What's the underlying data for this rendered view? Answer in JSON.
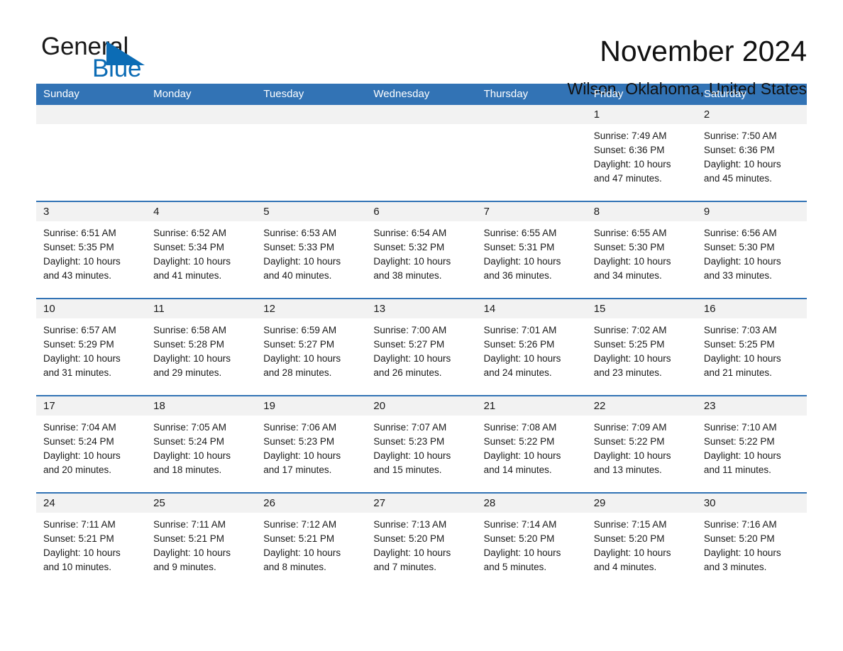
{
  "brand": {
    "name_part1": "General",
    "name_part2": "Blue",
    "logo_icon": "triangle-flag-icon",
    "accent_color": "#0c6cb5"
  },
  "header": {
    "month_title": "November 2024",
    "location": "Wilson, Oklahoma, United States"
  },
  "calendar": {
    "header_bg": "#3273b5",
    "row_border_color": "#3273b5",
    "day_strip_bg": "#f2f2f2",
    "weekdays": [
      "Sunday",
      "Monday",
      "Tuesday",
      "Wednesday",
      "Thursday",
      "Friday",
      "Saturday"
    ],
    "weeks": [
      [
        {
          "day": "",
          "sunrise": "",
          "sunset": "",
          "daylight_line1": "",
          "daylight_line2": "",
          "empty": true
        },
        {
          "day": "",
          "sunrise": "",
          "sunset": "",
          "daylight_line1": "",
          "daylight_line2": "",
          "empty": true
        },
        {
          "day": "",
          "sunrise": "",
          "sunset": "",
          "daylight_line1": "",
          "daylight_line2": "",
          "empty": true
        },
        {
          "day": "",
          "sunrise": "",
          "sunset": "",
          "daylight_line1": "",
          "daylight_line2": "",
          "empty": true
        },
        {
          "day": "",
          "sunrise": "",
          "sunset": "",
          "daylight_line1": "",
          "daylight_line2": "",
          "empty": true
        },
        {
          "day": "1",
          "sunrise": "Sunrise: 7:49 AM",
          "sunset": "Sunset: 6:36 PM",
          "daylight_line1": "Daylight: 10 hours",
          "daylight_line2": "and 47 minutes.",
          "empty": false
        },
        {
          "day": "2",
          "sunrise": "Sunrise: 7:50 AM",
          "sunset": "Sunset: 6:36 PM",
          "daylight_line1": "Daylight: 10 hours",
          "daylight_line2": "and 45 minutes.",
          "empty": false
        }
      ],
      [
        {
          "day": "3",
          "sunrise": "Sunrise: 6:51 AM",
          "sunset": "Sunset: 5:35 PM",
          "daylight_line1": "Daylight: 10 hours",
          "daylight_line2": "and 43 minutes.",
          "empty": false
        },
        {
          "day": "4",
          "sunrise": "Sunrise: 6:52 AM",
          "sunset": "Sunset: 5:34 PM",
          "daylight_line1": "Daylight: 10 hours",
          "daylight_line2": "and 41 minutes.",
          "empty": false
        },
        {
          "day": "5",
          "sunrise": "Sunrise: 6:53 AM",
          "sunset": "Sunset: 5:33 PM",
          "daylight_line1": "Daylight: 10 hours",
          "daylight_line2": "and 40 minutes.",
          "empty": false
        },
        {
          "day": "6",
          "sunrise": "Sunrise: 6:54 AM",
          "sunset": "Sunset: 5:32 PM",
          "daylight_line1": "Daylight: 10 hours",
          "daylight_line2": "and 38 minutes.",
          "empty": false
        },
        {
          "day": "7",
          "sunrise": "Sunrise: 6:55 AM",
          "sunset": "Sunset: 5:31 PM",
          "daylight_line1": "Daylight: 10 hours",
          "daylight_line2": "and 36 minutes.",
          "empty": false
        },
        {
          "day": "8",
          "sunrise": "Sunrise: 6:55 AM",
          "sunset": "Sunset: 5:30 PM",
          "daylight_line1": "Daylight: 10 hours",
          "daylight_line2": "and 34 minutes.",
          "empty": false
        },
        {
          "day": "9",
          "sunrise": "Sunrise: 6:56 AM",
          "sunset": "Sunset: 5:30 PM",
          "daylight_line1": "Daylight: 10 hours",
          "daylight_line2": "and 33 minutes.",
          "empty": false
        }
      ],
      [
        {
          "day": "10",
          "sunrise": "Sunrise: 6:57 AM",
          "sunset": "Sunset: 5:29 PM",
          "daylight_line1": "Daylight: 10 hours",
          "daylight_line2": "and 31 minutes.",
          "empty": false
        },
        {
          "day": "11",
          "sunrise": "Sunrise: 6:58 AM",
          "sunset": "Sunset: 5:28 PM",
          "daylight_line1": "Daylight: 10 hours",
          "daylight_line2": "and 29 minutes.",
          "empty": false
        },
        {
          "day": "12",
          "sunrise": "Sunrise: 6:59 AM",
          "sunset": "Sunset: 5:27 PM",
          "daylight_line1": "Daylight: 10 hours",
          "daylight_line2": "and 28 minutes.",
          "empty": false
        },
        {
          "day": "13",
          "sunrise": "Sunrise: 7:00 AM",
          "sunset": "Sunset: 5:27 PM",
          "daylight_line1": "Daylight: 10 hours",
          "daylight_line2": "and 26 minutes.",
          "empty": false
        },
        {
          "day": "14",
          "sunrise": "Sunrise: 7:01 AM",
          "sunset": "Sunset: 5:26 PM",
          "daylight_line1": "Daylight: 10 hours",
          "daylight_line2": "and 24 minutes.",
          "empty": false
        },
        {
          "day": "15",
          "sunrise": "Sunrise: 7:02 AM",
          "sunset": "Sunset: 5:25 PM",
          "daylight_line1": "Daylight: 10 hours",
          "daylight_line2": "and 23 minutes.",
          "empty": false
        },
        {
          "day": "16",
          "sunrise": "Sunrise: 7:03 AM",
          "sunset": "Sunset: 5:25 PM",
          "daylight_line1": "Daylight: 10 hours",
          "daylight_line2": "and 21 minutes.",
          "empty": false
        }
      ],
      [
        {
          "day": "17",
          "sunrise": "Sunrise: 7:04 AM",
          "sunset": "Sunset: 5:24 PM",
          "daylight_line1": "Daylight: 10 hours",
          "daylight_line2": "and 20 minutes.",
          "empty": false
        },
        {
          "day": "18",
          "sunrise": "Sunrise: 7:05 AM",
          "sunset": "Sunset: 5:24 PM",
          "daylight_line1": "Daylight: 10 hours",
          "daylight_line2": "and 18 minutes.",
          "empty": false
        },
        {
          "day": "19",
          "sunrise": "Sunrise: 7:06 AM",
          "sunset": "Sunset: 5:23 PM",
          "daylight_line1": "Daylight: 10 hours",
          "daylight_line2": "and 17 minutes.",
          "empty": false
        },
        {
          "day": "20",
          "sunrise": "Sunrise: 7:07 AM",
          "sunset": "Sunset: 5:23 PM",
          "daylight_line1": "Daylight: 10 hours",
          "daylight_line2": "and 15 minutes.",
          "empty": false
        },
        {
          "day": "21",
          "sunrise": "Sunrise: 7:08 AM",
          "sunset": "Sunset: 5:22 PM",
          "daylight_line1": "Daylight: 10 hours",
          "daylight_line2": "and 14 minutes.",
          "empty": false
        },
        {
          "day": "22",
          "sunrise": "Sunrise: 7:09 AM",
          "sunset": "Sunset: 5:22 PM",
          "daylight_line1": "Daylight: 10 hours",
          "daylight_line2": "and 13 minutes.",
          "empty": false
        },
        {
          "day": "23",
          "sunrise": "Sunrise: 7:10 AM",
          "sunset": "Sunset: 5:22 PM",
          "daylight_line1": "Daylight: 10 hours",
          "daylight_line2": "and 11 minutes.",
          "empty": false
        }
      ],
      [
        {
          "day": "24",
          "sunrise": "Sunrise: 7:11 AM",
          "sunset": "Sunset: 5:21 PM",
          "daylight_line1": "Daylight: 10 hours",
          "daylight_line2": "and 10 minutes.",
          "empty": false
        },
        {
          "day": "25",
          "sunrise": "Sunrise: 7:11 AM",
          "sunset": "Sunset: 5:21 PM",
          "daylight_line1": "Daylight: 10 hours",
          "daylight_line2": "and 9 minutes.",
          "empty": false
        },
        {
          "day": "26",
          "sunrise": "Sunrise: 7:12 AM",
          "sunset": "Sunset: 5:21 PM",
          "daylight_line1": "Daylight: 10 hours",
          "daylight_line2": "and 8 minutes.",
          "empty": false
        },
        {
          "day": "27",
          "sunrise": "Sunrise: 7:13 AM",
          "sunset": "Sunset: 5:20 PM",
          "daylight_line1": "Daylight: 10 hours",
          "daylight_line2": "and 7 minutes.",
          "empty": false
        },
        {
          "day": "28",
          "sunrise": "Sunrise: 7:14 AM",
          "sunset": "Sunset: 5:20 PM",
          "daylight_line1": "Daylight: 10 hours",
          "daylight_line2": "and 5 minutes.",
          "empty": false
        },
        {
          "day": "29",
          "sunrise": "Sunrise: 7:15 AM",
          "sunset": "Sunset: 5:20 PM",
          "daylight_line1": "Daylight: 10 hours",
          "daylight_line2": "and 4 minutes.",
          "empty": false
        },
        {
          "day": "30",
          "sunrise": "Sunrise: 7:16 AM",
          "sunset": "Sunset: 5:20 PM",
          "daylight_line1": "Daylight: 10 hours",
          "daylight_line2": "and 3 minutes.",
          "empty": false
        }
      ]
    ]
  }
}
